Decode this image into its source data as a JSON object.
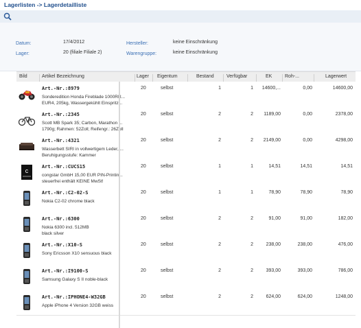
{
  "breadcrumb": "Lagerlisten -> Lagerdetailliste",
  "filters": {
    "datum_label": "Datum:",
    "datum_value": "17/4/2012",
    "lager_label": "Lager:",
    "lager_value": "20 (filiale Filiale 2)",
    "hersteller_label": "Hersteller:",
    "hersteller_value": "keine Einschränkung",
    "warengruppe_label": "Warengruppe:",
    "warengruppe_value": "keine Einschränkung"
  },
  "columns": [
    "Bild",
    "Artikel Bezeichnung",
    "Lager",
    "Eigentum",
    "Bestand",
    "Verfügbar",
    "EK",
    "Roh-...",
    "Lagerwert"
  ],
  "rows": [
    {
      "icon": "motorcycle-image",
      "art": "Art.-Nr.:8979",
      "desc": "Sonderedition Honda Fireblade 1000RR...\nEUR4, 205kg, Wassergekühlt Einspritz...",
      "lager": "20",
      "eigentum": "selbst",
      "bestand": "1",
      "verfuegbar": "1",
      "ek": "14600,...",
      "roh": "0,00",
      "wert": "14600,00"
    },
    {
      "icon": "bicycle-image",
      "art": "Art.-Nr.:2345",
      "desc": "Scott MB Spark 35; Carbon, Marathon ...\n1790g; Rahmen: 52Zoll; Reifengr.: 26Zoll",
      "lager": "20",
      "eigentum": "selbst",
      "bestand": "2",
      "verfuegbar": "2",
      "ek": "1189,00",
      "roh": "0,00",
      "wert": "2378,00"
    },
    {
      "icon": "waterbed-image",
      "art": "Art.-Nr.:4321",
      "desc": "Wasserbett SIRI in vollwertigem Leder, ...\nBeruhigungsstufe: Kammer",
      "lager": "20",
      "eigentum": "selbst",
      "bestand": "2",
      "verfuegbar": "2",
      "ek": "2149,00",
      "roh": "0,00",
      "wert": "4298,00"
    },
    {
      "icon": "congstar-card-image",
      "art": "Art.-Nr.:CUCS15",
      "desc": "congstar GmbH 15,00 EUR PIN-Printin...\nsteuerfrei enthält KEINE MwSt!",
      "lager": "20",
      "eigentum": "selbst",
      "bestand": "1",
      "verfuegbar": "1",
      "ek": "14,51",
      "roh": "14,51",
      "wert": "14,51"
    },
    {
      "icon": "phone-image",
      "art": "Art.-Nr.:C2-02-S",
      "desc": "Nokia C2-02 chrome black",
      "lager": "20",
      "eigentum": "selbst",
      "bestand": "1",
      "verfuegbar": "1",
      "ek": "78,90",
      "roh": "78,90",
      "wert": "78,90"
    },
    {
      "icon": "phone-image",
      "art": "Art.-Nr.:6300",
      "desc": "Nokia 6300 incl. 512MB\nblack silver",
      "lager": "20",
      "eigentum": "selbst",
      "bestand": "2",
      "verfuegbar": "2",
      "ek": "91,00",
      "roh": "91,00",
      "wert": "182,00"
    },
    {
      "icon": "phone-image",
      "art": "Art.-Nr.:X10-S",
      "desc": "Sony Ericsson X10 sensuous black",
      "lager": "20",
      "eigentum": "selbst",
      "bestand": "2",
      "verfuegbar": "2",
      "ek": "238,00",
      "roh": "238,00",
      "wert": "476,00"
    },
    {
      "icon": "phone-image",
      "art": "Art.-Nr.:I9100-S",
      "desc": "Samsung Galaxy S II noble-black",
      "lager": "20",
      "eigentum": "selbst",
      "bestand": "2",
      "verfuegbar": "2",
      "ek": "393,00",
      "roh": "393,00",
      "wert": "786,00"
    },
    {
      "icon": "phone-image",
      "art": "Art.-Nr.:IPHONE4-W32GB",
      "desc": "Apple iPhone 4 Version 32GB weiss",
      "lager": "20",
      "eigentum": "selbst",
      "bestand": "2",
      "verfuegbar": "2",
      "ek": "624,00",
      "roh": "624,00",
      "wert": "1248,00"
    }
  ]
}
